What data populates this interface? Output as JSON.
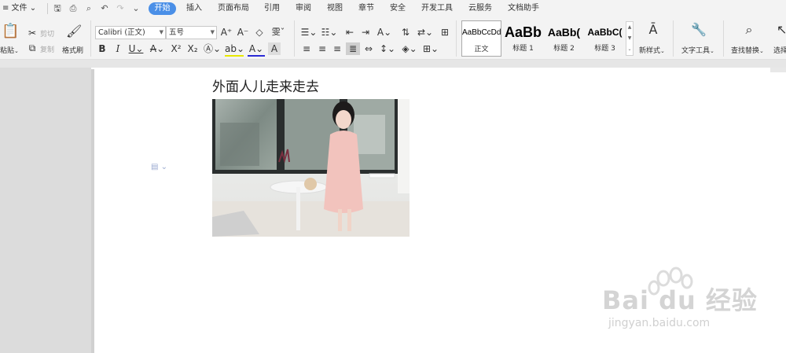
{
  "menubar": {
    "file": "≡ 文件",
    "tabs": [
      "开始",
      "插入",
      "页面布局",
      "引用",
      "审阅",
      "视图",
      "章节",
      "安全",
      "开发工具",
      "云服务",
      "文档助手"
    ]
  },
  "ribbon": {
    "paste": "粘贴",
    "cut": "剪切",
    "copy": "复制",
    "format_painter": "格式刷",
    "font_name": "Calibri (正文)",
    "font_size": "五号",
    "styles": [
      {
        "preview": "AaBbCcDd",
        "name": "正文"
      },
      {
        "preview": "AaBb",
        "name": "标题 1"
      },
      {
        "preview": "AaBb(",
        "name": "标题 2"
      },
      {
        "preview": "AaBbC(",
        "name": "标题 3"
      }
    ],
    "new_style": "新样式",
    "text_tools": "文字工具",
    "find_replace": "查找替换",
    "select": "选择"
  },
  "document": {
    "heading": "外面人儿走来走去"
  },
  "watermark": {
    "text": "Bai du 经验",
    "url": "jingyan.baidu.com"
  },
  "colors": {
    "accent": "#4a8fe7",
    "font_color_underline": "#2b2bd6",
    "highlight_underline": "#e8e800"
  }
}
